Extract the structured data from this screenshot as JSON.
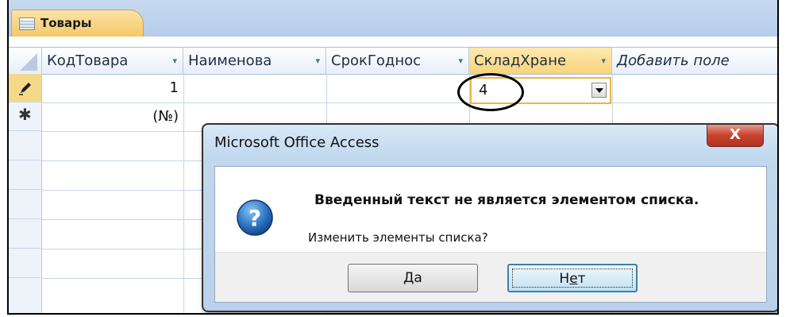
{
  "tab": {
    "label": "Товары"
  },
  "columns": [
    {
      "label": "КодТовара",
      "arrow": "▾"
    },
    {
      "label": "Наименова",
      "arrow": "▾"
    },
    {
      "label": "СрокГоднос",
      "arrow": "▾"
    },
    {
      "label": "СкладХране",
      "arrow": "▾"
    }
  ],
  "add_field": "Добавить поле",
  "rows": [
    {
      "selector_icon": "pencil-icon",
      "kod": "1",
      "sklad": "4"
    },
    {
      "selector_icon": "new-record-star-icon",
      "selector_glyph": "✱",
      "kod": "(№)"
    }
  ],
  "dialog": {
    "title": "Microsoft Office Access",
    "close_glyph": "X",
    "icon": "question-icon",
    "message": "Введенный текст не является элементом списка.",
    "question": "Изменить элементы списка?",
    "yes": {
      "pre": "",
      "accel": "Д",
      "post": "а"
    },
    "no": {
      "pre": "Н",
      "accel": "е",
      "post": "т"
    }
  },
  "colors": {
    "tab_fill": "#f5c869",
    "header_bg": "#e7eef8",
    "active_column": "#f8d47b",
    "combo_border": "#f0b441",
    "close_button": "#c7432f"
  }
}
